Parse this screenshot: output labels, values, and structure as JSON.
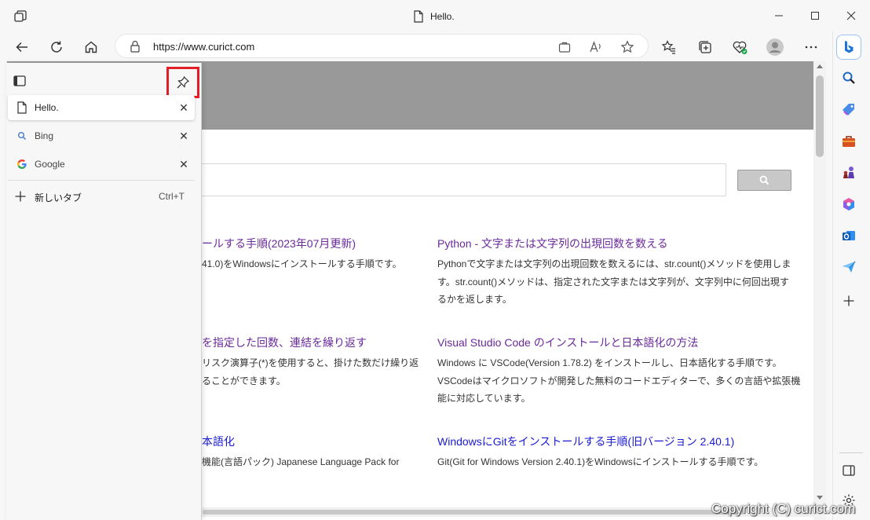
{
  "window": {
    "title": "Hello."
  },
  "addressbar": {
    "url": "https://www.curict.com"
  },
  "tabs": {
    "items": [
      {
        "label": "Hello.",
        "favicon": "page-icon",
        "active": true
      },
      {
        "label": "Bing",
        "favicon": "search-icon",
        "active": false
      },
      {
        "label": "Google",
        "favicon": "google-icon",
        "active": false
      }
    ],
    "new_tab_label": "新しいタブ",
    "new_tab_shortcut": "Ctrl+T"
  },
  "page": {
    "articles": [
      {
        "title": "ールする手順(2023年07月更新)",
        "desc": [
          "41.0)をWindowsにインストールする手順です。"
        ]
      },
      {
        "title": "Python - 文字または文字列の出現回数を数える",
        "desc": [
          "Pythonで文字または文字列の出現回数を数えるには、str.count()メソッドを使用しま",
          "す。str.count()メソッドは、指定された文字または文字列が、文字列中に何回出現す",
          "るかを返します。"
        ]
      },
      {
        "title": "を指定した回数、連結を繰り返す",
        "desc": [
          "リスク演算子(*)を使用すると、掛けた数だけ繰り返",
          "ることができます。"
        ]
      },
      {
        "title": "Visual Studio Code のインストールと日本語化の方法",
        "desc": [
          "Windows に VSCode(Version 1.78.2) をインストールし、日本語化する手順です。",
          "VSCodeはマイクロソフトが開発した無料のコードエディターで、多くの言語や拡張機",
          "能に対応しています。"
        ]
      },
      {
        "title": "本語化",
        "desc": [
          "機能(言語パック) Japanese Language Pack for"
        ]
      },
      {
        "title": "WindowsにGitをインストールする手順(旧バージョン 2.40.1)",
        "desc": [
          "Git(Git for Windows Version 2.40.1)をWindowsにインストールする手順です。"
        ]
      }
    ]
  },
  "watermark": "Copyright (C) curict.com",
  "colors": {
    "pin_highlight": "#e21e26",
    "visited_link": "#6a2a9a",
    "link": "#1a1ad1",
    "site_header": "#999999"
  }
}
